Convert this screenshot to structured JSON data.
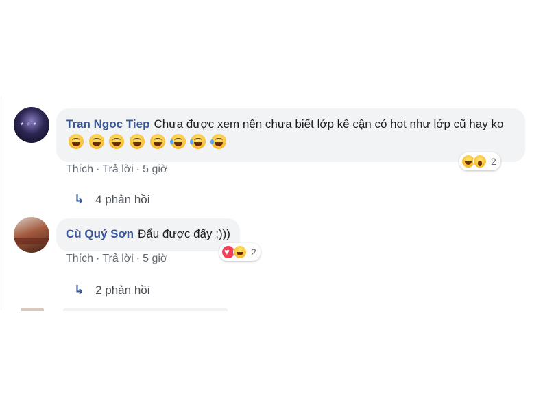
{
  "comments": [
    {
      "author": "Tran Ngoc Tiep",
      "text": "Chưa được xem nên chưa biết lớp kế cận có hot như lớp cũ hay ko",
      "emojis": [
        "grin",
        "grin",
        "grin",
        "grin",
        "grin",
        "tears-of-joy",
        "tears-of-joy",
        "tears-of-joy"
      ],
      "reactions": {
        "icons": [
          "haha",
          "wow"
        ],
        "count": "2"
      },
      "actions": {
        "like": "Thích",
        "reply": "Trả lời",
        "time": "5 giờ"
      },
      "replies": "4 phản hồi"
    },
    {
      "author": "Cù Quý Sơn",
      "text": "Đẩu được đấy ;)))",
      "reactions": {
        "icons": [
          "love",
          "haha"
        ],
        "count": "2"
      },
      "actions": {
        "like": "Thích",
        "reply": "Trả lời",
        "time": "5 giờ"
      },
      "replies": "2 phản hồi"
    }
  ],
  "colors": {
    "author_link": "#385898",
    "bubble_bg": "#f2f3f5",
    "meta_text": "#606770",
    "love": "#f33e58"
  }
}
